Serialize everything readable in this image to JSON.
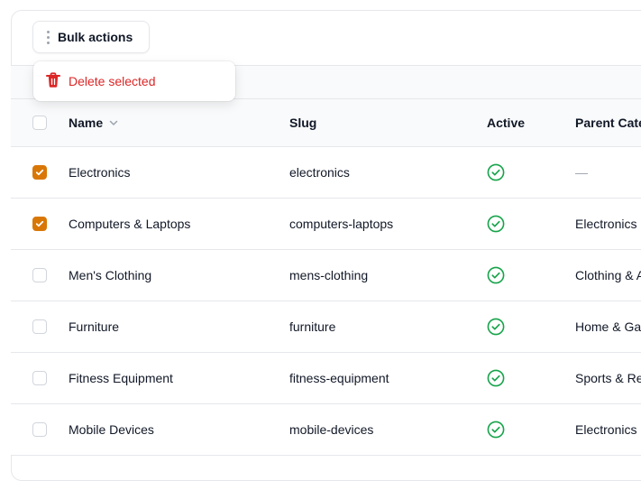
{
  "toolbar": {
    "bulk_label": "Bulk actions"
  },
  "dropdown": {
    "delete_label": "Delete selected"
  },
  "table": {
    "columns": {
      "name": "Name",
      "slug": "Slug",
      "active": "Active",
      "parent": "Parent Categ"
    },
    "rows": [
      {
        "name": "Electronics",
        "slug": "electronics",
        "active": true,
        "parent": "—",
        "selected": true
      },
      {
        "name": "Computers & Laptops",
        "slug": "computers-laptops",
        "active": true,
        "parent": "Electronics",
        "selected": true
      },
      {
        "name": "Men's Clothing",
        "slug": "mens-clothing",
        "active": true,
        "parent": "Clothing & A",
        "selected": false
      },
      {
        "name": "Furniture",
        "slug": "furniture",
        "active": true,
        "parent": "Home & Gard",
        "selected": false
      },
      {
        "name": "Fitness Equipment",
        "slug": "fitness-equipment",
        "active": true,
        "parent": "Sports & Re",
        "selected": false
      },
      {
        "name": "Mobile Devices",
        "slug": "mobile-devices",
        "active": true,
        "parent": "Electronics",
        "selected": false
      }
    ]
  },
  "colors": {
    "accent": "#d97706",
    "danger": "#dc2626",
    "success": "#16a34a"
  }
}
